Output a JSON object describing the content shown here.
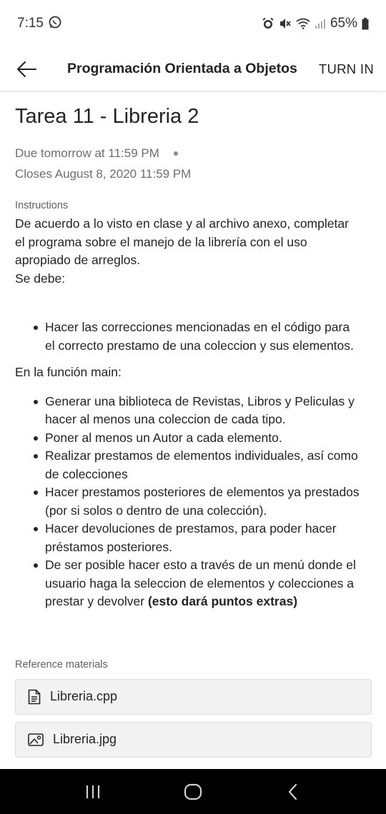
{
  "status_bar": {
    "time": "7:15",
    "battery": "65%",
    "icons": [
      "whatsapp-icon",
      "alarm-icon",
      "mute-icon",
      "wifi-icon",
      "signal-icon",
      "battery-icon"
    ]
  },
  "header": {
    "title": "Programación Orientada a Objetos",
    "turn_in_label": "TURN IN"
  },
  "assignment": {
    "title": "Tarea 11 - Libreria 2",
    "due": "Due tomorrow at 11:59 PM",
    "closes": "Closes August 8, 2020 11:59 PM"
  },
  "instructions": {
    "label": "Instructions",
    "intro_lines": [
      "De acuerdo a lo visto en clase y al archivo anexo, completar",
      "el programa sobre el manejo de la librería con el uso",
      "apropiado de arreglos.",
      "Se debe:"
    ],
    "bullets1": [
      [
        "Hacer las correcciones mencionadas en el código para",
        "el correcto prestamo de una coleccion y sus elementos."
      ]
    ],
    "main_label": "En la función main:",
    "bullets2": [
      [
        "Generar una biblioteca de Revistas, Libros y Peliculas y",
        "hacer al menos una coleccion de cada tipo."
      ],
      [
        "Poner al menos un Autor a cada elemento."
      ],
      [
        "Realizar prestamos de elementos individuales, así como",
        "de colecciones"
      ],
      [
        "Hacer prestamos posteriores de elementos ya prestados",
        "(por si solos o dentro de una colección)."
      ],
      [
        "Hacer devoluciones de prestamos, para poder hacer",
        "préstamos posteriores."
      ],
      [
        "De ser posible hacer esto a través de un menú donde el",
        "usuario haga la seleccion de elementos y colecciones a"
      ]
    ],
    "last_line_normal": "prestar y devolver ",
    "last_line_bold": "(esto dará puntos extras)"
  },
  "reference": {
    "label": "Reference materials",
    "files": [
      {
        "name": "Libreria.cpp",
        "icon": "document-icon"
      },
      {
        "name": "Libreria.jpg",
        "icon": "image-icon"
      }
    ]
  },
  "nav": {
    "icons": [
      "recent-apps-icon",
      "home-icon",
      "back-nav-icon"
    ]
  }
}
